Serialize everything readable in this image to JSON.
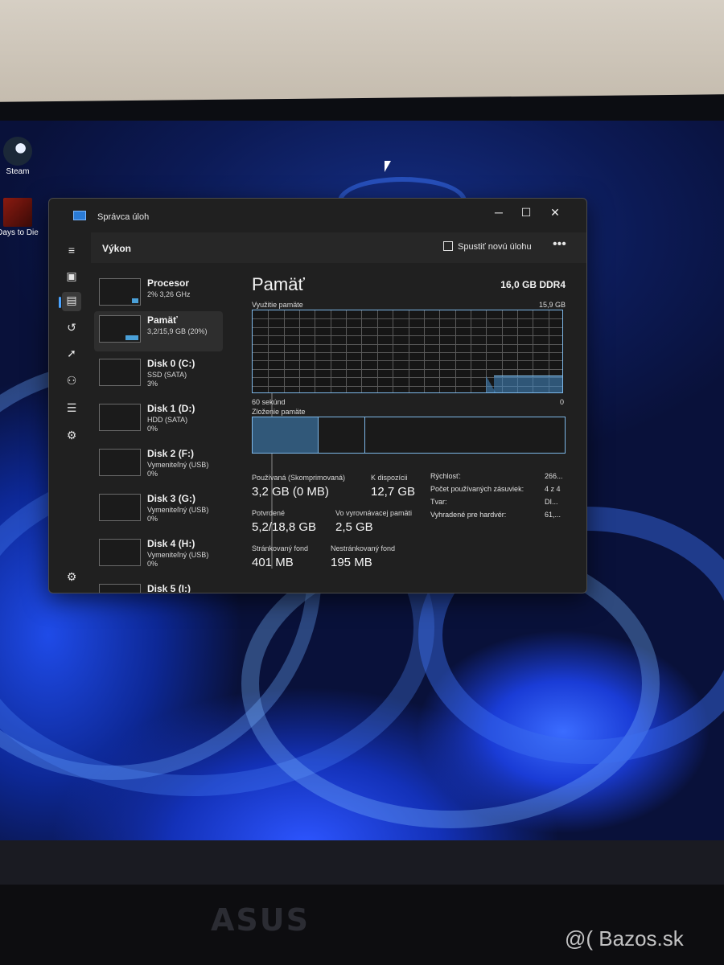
{
  "desktop": {
    "icons": [
      {
        "label": "Steam"
      },
      {
        "label": "Days to Die"
      }
    ],
    "monitor_brand": "ASUS",
    "watermark": "@( Bazos.sk"
  },
  "window": {
    "title": "Správca úloh",
    "controls": {
      "minimize": "─",
      "maximize": "☐",
      "close": "✕"
    }
  },
  "header": {
    "page_title": "Výkon",
    "run_task_label": "Spustiť novú úlohu",
    "more_label": "•••"
  },
  "sidebar": {
    "items": [
      {
        "icon": "hamburger-icon",
        "glyph": "≡"
      },
      {
        "icon": "processes-icon",
        "glyph": "▣"
      },
      {
        "icon": "performance-icon",
        "glyph": "▤"
      },
      {
        "icon": "history-icon",
        "glyph": "↺"
      },
      {
        "icon": "startup-icon",
        "glyph": "➚"
      },
      {
        "icon": "users-icon",
        "glyph": "⚇"
      },
      {
        "icon": "details-icon",
        "glyph": "☰"
      },
      {
        "icon": "services-icon",
        "glyph": "⚙"
      },
      {
        "icon": "settings-icon",
        "glyph": "⚙"
      }
    ]
  },
  "devices": [
    {
      "name": "Procesor",
      "line1": "2% 3,26 GHz",
      "line2": ""
    },
    {
      "name": "Pamäť",
      "line1": "3,2/15,9 GB (20%)",
      "line2": ""
    },
    {
      "name": "Disk 0 (C:)",
      "line1": "SSD (SATA)",
      "line2": "3%"
    },
    {
      "name": "Disk 1 (D:)",
      "line1": "HDD (SATA)",
      "line2": "0%"
    },
    {
      "name": "Disk 2 (F:)",
      "line1": "Vymeniteľný (USB)",
      "line2": "0%"
    },
    {
      "name": "Disk 3 (G:)",
      "line1": "Vymeniteľný (USB)",
      "line2": "0%"
    },
    {
      "name": "Disk 4 (H:)",
      "line1": "Vymeniteľný (USB)",
      "line2": "0%"
    },
    {
      "name": "Disk 5 (I:)",
      "line1": "",
      "line2": ""
    }
  ],
  "memory": {
    "title": "Pamäť",
    "type": "16,0 GB DDR4",
    "usage_label": "Využitie pamäte",
    "usage_max": "15,9 GB",
    "time_label": "60 sekúnd",
    "zero_label": "0",
    "usage_fraction": 0.2,
    "composition_label": "Zloženie pamäte",
    "stats": {
      "in_use_label": "Používaná (Skomprimovaná)",
      "in_use_value": "3,2 GB (0 MB)",
      "available_label": "K dispozícii",
      "available_value": "12,7 GB",
      "committed_label": "Potvrdené",
      "committed_value": "5,2/18,8 GB",
      "cached_label": "Vo vyrovnávacej pamäti",
      "cached_value": "2,5 GB",
      "paged_label": "Stránkovaný fond",
      "paged_value": "401 MB",
      "nonpaged_label": "Nestránkovaný fond",
      "nonpaged_value": "195 MB"
    },
    "details": [
      {
        "label": "Rýchlosť:",
        "value": "266..."
      },
      {
        "label": "Počet používaných zásuviek:",
        "value": "4 z 4"
      },
      {
        "label": "Tvar:",
        "value": "DI..."
      },
      {
        "label": "Vyhradené pre hardvér:",
        "value": "61,..."
      }
    ]
  }
}
